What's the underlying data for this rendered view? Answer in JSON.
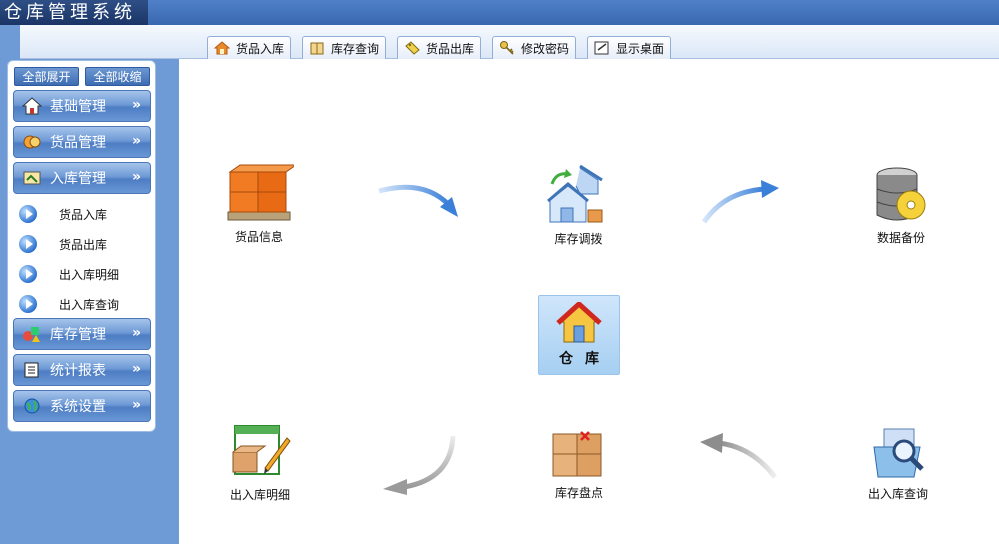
{
  "app": {
    "title": "仓库管理系统"
  },
  "tabs": [
    {
      "label": "货品入库",
      "icon": "home-icon"
    },
    {
      "label": "库存查询",
      "icon": "book-icon"
    },
    {
      "label": "货品出库",
      "icon": "tag-icon"
    },
    {
      "label": "修改密码",
      "icon": "key-icon"
    },
    {
      "label": "显示桌面",
      "icon": "desktop-icon"
    }
  ],
  "sidebar": {
    "expand_all": "全部展开",
    "collapse_all": "全部收缩",
    "groups": [
      {
        "label": "基础管理",
        "icon": "house-icon",
        "chevron": "»"
      },
      {
        "label": "货品管理",
        "icon": "coins-icon",
        "chevron": "»"
      },
      {
        "label": "入库管理",
        "icon": "inbox-icon",
        "chevron": "»"
      },
      {
        "label": "库存管理",
        "icon": "shapes-icon",
        "chevron": "»"
      },
      {
        "label": "统计报表",
        "icon": "report-icon",
        "chevron": "»"
      },
      {
        "label": "系统设置",
        "icon": "globe-icon",
        "chevron": "»"
      }
    ],
    "sub_items": [
      {
        "label": "货品入库"
      },
      {
        "label": "货品出库"
      },
      {
        "label": "出入库明细"
      },
      {
        "label": "出入库查询"
      }
    ]
  },
  "desktop": {
    "nodes": [
      {
        "label": "货品信息",
        "icon": "boxes-pallet-icon"
      },
      {
        "label": "库存调拨",
        "icon": "warehouse-transfer-icon"
      },
      {
        "label": "数据备份",
        "icon": "database-backup-icon"
      },
      {
        "label": "出入库明细",
        "icon": "detail-list-icon"
      },
      {
        "label": "库存盘点",
        "icon": "stock-check-icon"
      },
      {
        "label": "出入库查询",
        "icon": "search-folder-icon"
      }
    ],
    "center": {
      "label": "仓库",
      "icon": "warehouse-home-icon"
    }
  },
  "colors": {
    "sidebar_head": "#5b89cc",
    "canvas": "#ffffff",
    "frame": "#6e9ad6"
  }
}
